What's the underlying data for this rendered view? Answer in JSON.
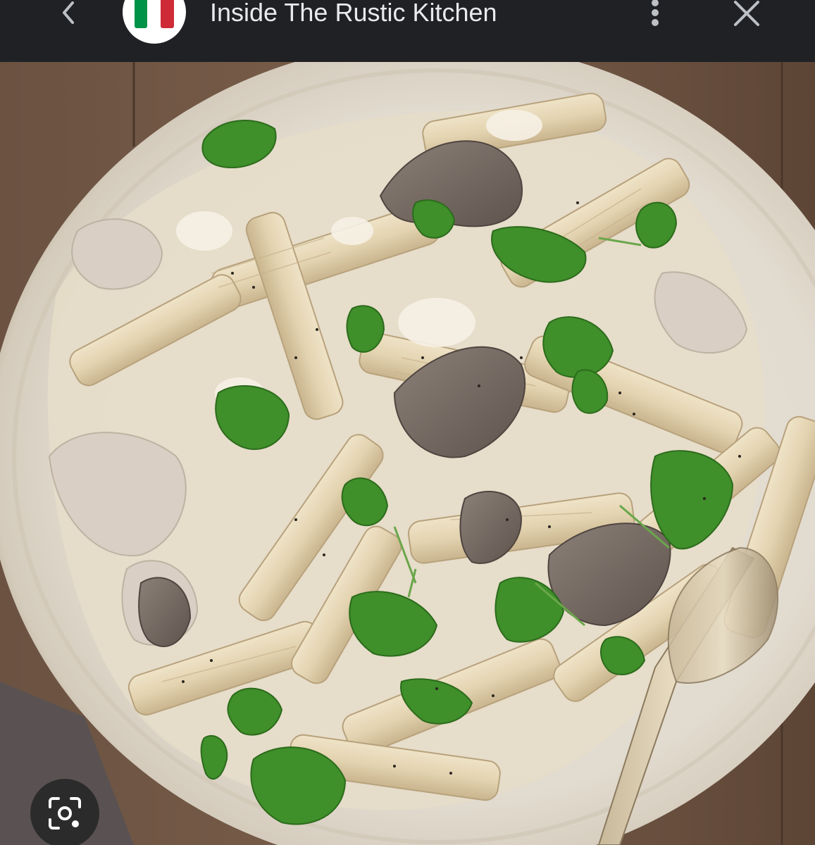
{
  "header": {
    "title": "Inside The Rustic Kitchen",
    "back_icon": "chevron-left-icon",
    "logo_icon": "italian-flag-icon",
    "more_icon": "more-vert-icon",
    "close_icon": "close-icon"
  },
  "image": {
    "subject": "penne-pasta-with-mushrooms-in-bowl"
  },
  "actions": {
    "lens_icon": "visual-search-icon"
  },
  "colors": {
    "topbar": "#202124",
    "title_text": "#e8eaed",
    "flag_green": "#009246",
    "flag_white": "#ffffff",
    "flag_red": "#ce2b37"
  }
}
